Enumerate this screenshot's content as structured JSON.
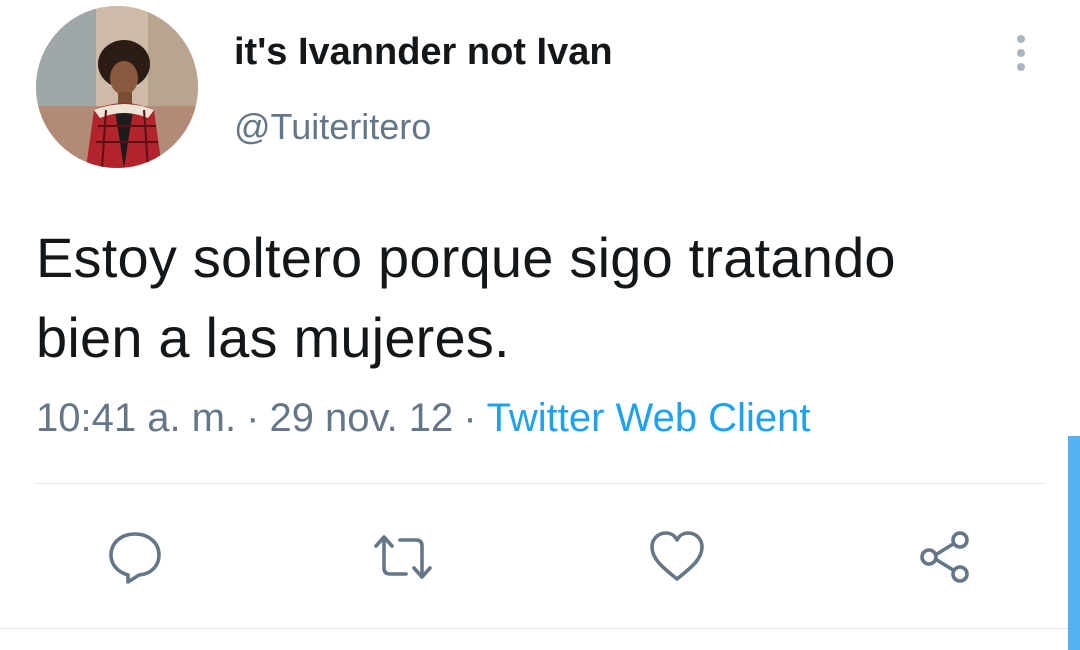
{
  "tweet": {
    "author": {
      "display_name": "it's Ivannder not Ivan",
      "handle": "@Tuiteritero",
      "avatar_icon": "profile-photo"
    },
    "text_line1": "Estoy soltero porque sigo tratando",
    "text_line2": "bien a las mujeres.",
    "time": "10:41 a. m.",
    "date": "29 nov. 12",
    "separator": "·",
    "source": "Twitter Web Client",
    "actions": [
      {
        "name": "reply",
        "icon": "reply-icon"
      },
      {
        "name": "retweet",
        "icon": "retweet-icon"
      },
      {
        "name": "like",
        "icon": "heart-icon"
      },
      {
        "name": "share",
        "icon": "share-icon"
      }
    ]
  },
  "colors": {
    "text": "#14171a",
    "secondary": "#657786",
    "link": "#1da1f2",
    "icon": "#657786",
    "divider": "#e1e8ed"
  }
}
